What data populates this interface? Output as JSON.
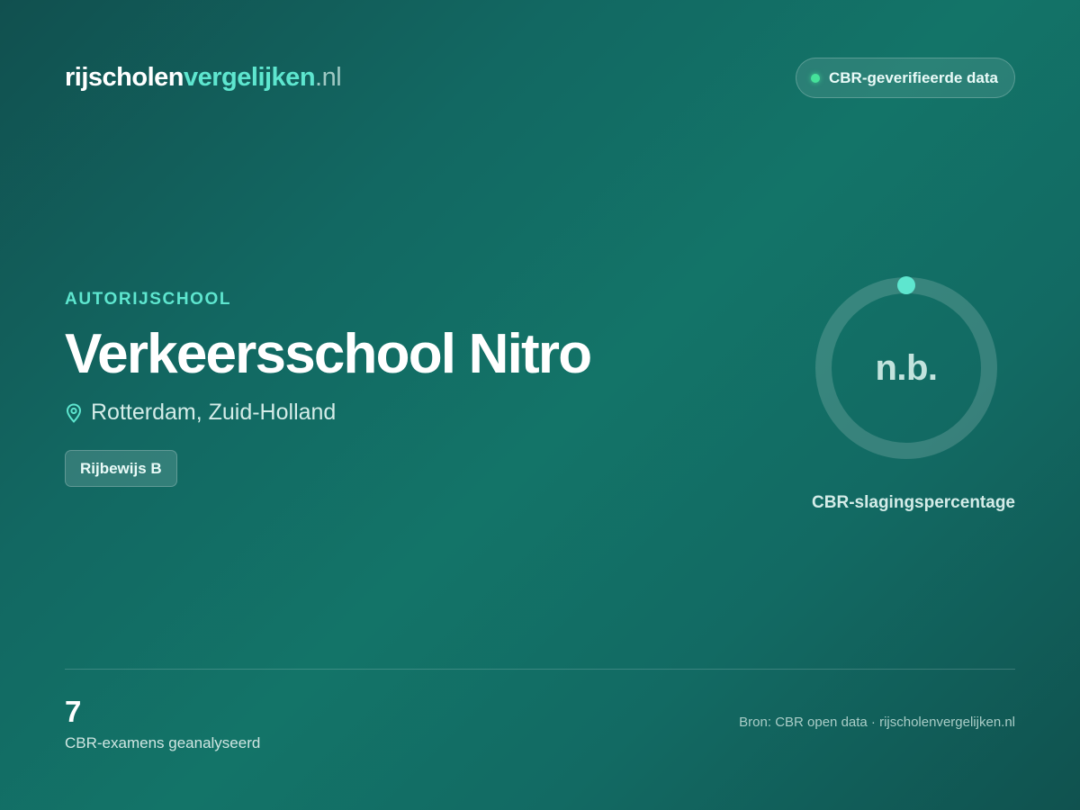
{
  "header": {
    "logo": {
      "part_a": "rijscholen",
      "part_b": "vergelijken",
      "part_c": ".nl"
    },
    "badge": {
      "text": "CBR-geverifieerde data",
      "dot_color": "#45e29a"
    }
  },
  "school": {
    "category": "AUTORIJSCHOOL",
    "name": "Verkeersschool Nitro",
    "location": "Rotterdam, Zuid-Holland",
    "location_icon": "map-pin-icon",
    "license": "Rijbewijs B"
  },
  "score": {
    "value": "n.b.",
    "label": "CBR-slagingspercentage",
    "percent": 0,
    "accent_color": "#5ee6cf"
  },
  "footer": {
    "exam_count": "7",
    "exam_label": "CBR-examens geanalyseerd",
    "source": "Bron: CBR open data · rijscholenvergelijken.nl"
  },
  "colors": {
    "accent": "#5ee6cf",
    "background": "#137468"
  }
}
